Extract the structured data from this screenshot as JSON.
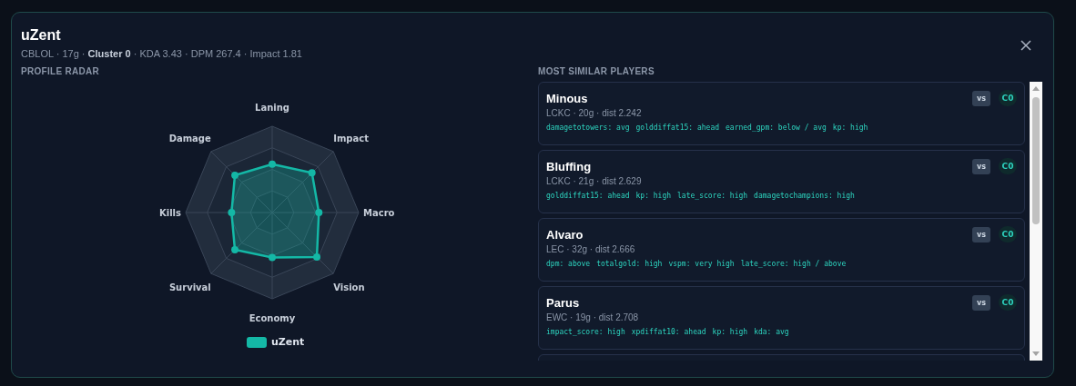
{
  "player": {
    "name": "uZent",
    "subtitle": "CBLOL · 17g · **Cluster 0** · KDA 3.43 · DPM 267.4 · Impact 1.81"
  },
  "radar": {
    "title": "PROFILE RADAR",
    "axes": [
      "Laning",
      "Damage",
      "Impact",
      "Kills",
      "Macro",
      "Survival",
      "Vision",
      "Economy"
    ],
    "legend": {
      "label": "uZent",
      "color": "#14b8a6"
    }
  },
  "similar": {
    "title": "MOST SIMILAR PLAYERS",
    "players": [
      {
        "name": "Minous",
        "meta": "LCKC · 20g · dist 2.242",
        "tags": [
          "damagetotowers: avg",
          "golddiffat15: ahead",
          "earned_gpm: below / avg",
          "kp: high"
        ],
        "vs": "vs",
        "cluster": "C0"
      },
      {
        "name": "Bluffing",
        "meta": "LCKC · 21g · dist 2.629",
        "tags": [
          "golddiffat15: ahead",
          "kp: high",
          "late_score: high",
          "damagetochampions: high"
        ],
        "vs": "vs",
        "cluster": "C0"
      },
      {
        "name": "Alvaro",
        "meta": "LEC · 32g · dist 2.666",
        "tags": [
          "dpm: above",
          "totalgold: high",
          "vspm: very high",
          "late_score: high / above"
        ],
        "vs": "vs",
        "cluster": "C0"
      },
      {
        "name": "Parus",
        "meta": "EWC · 19g · dist 2.708",
        "tags": [
          "impact_score: high",
          "xpdiffat10: ahead",
          "kp: high",
          "kda: avg"
        ],
        "vs": "vs",
        "cluster": "C0"
      }
    ]
  }
}
